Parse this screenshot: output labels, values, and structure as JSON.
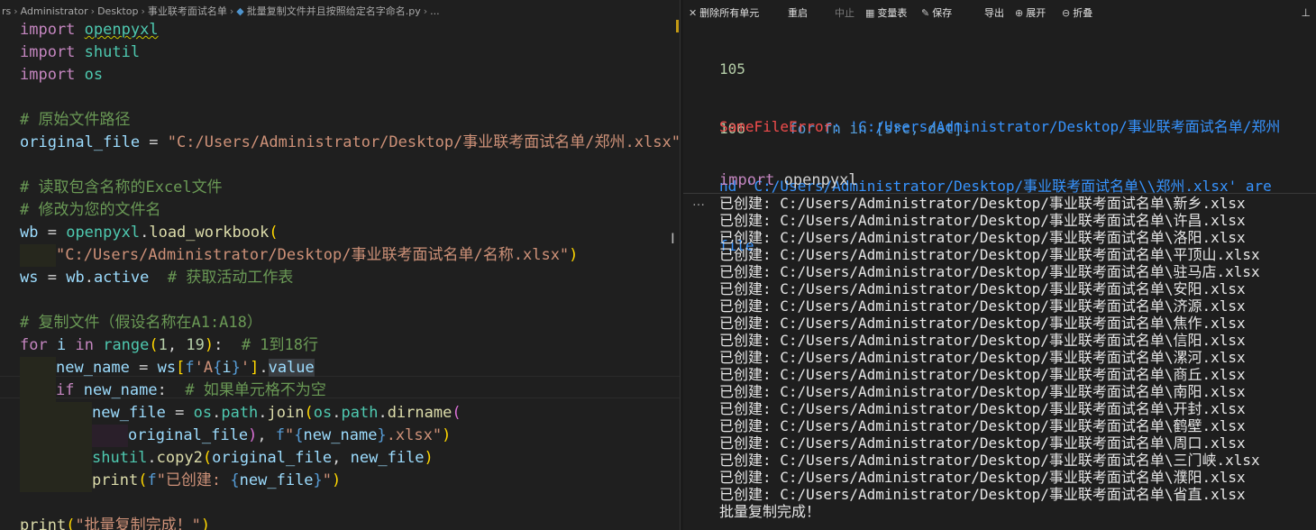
{
  "editor": {
    "breadcrumb": [
      "rs",
      "Administrator",
      "Desktop",
      "事业联考面试名单",
      "批量复制文件并且按照给定名字命名.py",
      "..."
    ],
    "code": {
      "import1_kw": "import",
      "import1_mod": "openpyxl",
      "import2_kw": "import",
      "import2_mod": "shutil",
      "import3_kw": "import",
      "import3_mod": "os",
      "comment_path": "# 原始文件路径",
      "original_var": "original_file",
      "original_str": "\"C:/Users/Administrator/Desktop/事业联考面试名单/郑州.xlsx\"",
      "comment_read": "# 读取包含名称的Excel文件",
      "comment_modify": "# 修改为您的文件名",
      "wb_var": "wb",
      "wb_mod": "openpyxl",
      "wb_fn": "load_workbook",
      "wb_str": "\"C:/Users/Administrator/Desktop/事业联考面试名单/名称.xlsx\"",
      "ws_var": "ws",
      "ws_wb": "wb",
      "ws_attr": "active",
      "comment_active": "# 获取活动工作表",
      "comment_copy": "# 复制文件（假设名称在A1:A18）",
      "for_kw": "for",
      "for_var": "i",
      "in_kw": "in",
      "range_fn": "range",
      "range_a": "1",
      "range_b": "19",
      "comment_range": "# 1到18行",
      "newname_var": "new_name",
      "ws2": "ws",
      "fstr_prefix": "f",
      "fstr_open": "'A",
      "fstr_i": "i",
      "fstr_close": "'",
      "value_attr": "value",
      "if_kw": "if",
      "if_var": "new_name",
      "comment_if": "# 如果单元格不为空",
      "newfile_var": "new_file",
      "os1": "os",
      "path1": "path",
      "join_fn": "join",
      "os2": "os",
      "path2": "path",
      "dirname_fn": "dirname",
      "orig_arg": "original_file",
      "f2": "f",
      "f2_open": "\"",
      "f2_var": "new_name",
      "f2_close": ".xlsx\"",
      "shutil_mod": "shutil",
      "copy_fn": "copy2",
      "copy_a": "original_file",
      "copy_b": "new_file",
      "print_fn": "print",
      "print_f": "f",
      "print_open": "\"已创建: ",
      "print_var": "new_file",
      "print_close": "\"",
      "print2_fn": "print",
      "print2_str": "\"批量复制完成！\""
    }
  },
  "toolbar": {
    "clear_outputs": "删除所有单元",
    "restart": "重启",
    "interrupt": "中止",
    "variables": "变量表",
    "save": "保存",
    "export": "导出",
    "expand": "展开",
    "collapse": "折叠"
  },
  "traceback": {
    "line105_no": "105",
    "line106_no": "106",
    "line106_code": "for fn in [src, dst]:",
    "error_name": "SameFileError",
    "error_line1": ": 'C:/Users/Administrator/Desktop/事业联考面试名单/郑州",
    "error_line2": "nd 'C:/Users/Administrator/Desktop/事业联考面试名单\\\\郑州.xlsx' are",
    "error_line3": "file"
  },
  "cell": {
    "header_kw": "import",
    "header_mod": "openpyxl"
  },
  "output": {
    "lines": [
      "已创建: C:/Users/Administrator/Desktop/事业联考面试名单\\新乡.xlsx",
      "已创建: C:/Users/Administrator/Desktop/事业联考面试名单\\许昌.xlsx",
      "已创建: C:/Users/Administrator/Desktop/事业联考面试名单\\洛阳.xlsx",
      "已创建: C:/Users/Administrator/Desktop/事业联考面试名单\\平顶山.xlsx",
      "已创建: C:/Users/Administrator/Desktop/事业联考面试名单\\驻马店.xlsx",
      "已创建: C:/Users/Administrator/Desktop/事业联考面试名单\\安阳.xlsx",
      "已创建: C:/Users/Administrator/Desktop/事业联考面试名单\\济源.xlsx",
      "已创建: C:/Users/Administrator/Desktop/事业联考面试名单\\焦作.xlsx",
      "已创建: C:/Users/Administrator/Desktop/事业联考面试名单\\信阳.xlsx",
      "已创建: C:/Users/Administrator/Desktop/事业联考面试名单\\漯河.xlsx",
      "已创建: C:/Users/Administrator/Desktop/事业联考面试名单\\商丘.xlsx",
      "已创建: C:/Users/Administrator/Desktop/事业联考面试名单\\南阳.xlsx",
      "已创建: C:/Users/Administrator/Desktop/事业联考面试名单\\开封.xlsx",
      "已创建: C:/Users/Administrator/Desktop/事业联考面试名单\\鹤壁.xlsx",
      "已创建: C:/Users/Administrator/Desktop/事业联考面试名单\\周口.xlsx",
      "已创建: C:/Users/Administrator/Desktop/事业联考面试名单\\三门峡.xlsx",
      "已创建: C:/Users/Administrator/Desktop/事业联考面试名单\\濮阳.xlsx",
      "已创建: C:/Users/Administrator/Desktop/事业联考面试名单\\省直.xlsx",
      "批量复制完成！"
    ]
  }
}
